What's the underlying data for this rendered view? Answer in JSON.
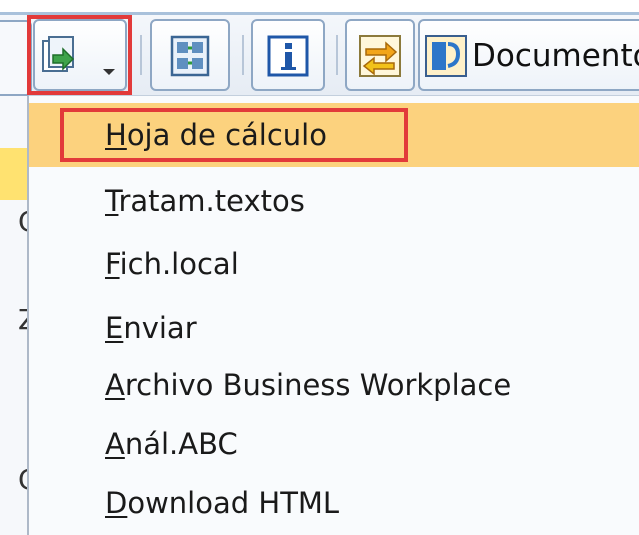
{
  "toolbar": {
    "buttons": [
      {
        "icon": "export-icon",
        "dropdown": true
      },
      {
        "icon": "layout-icon"
      },
      {
        "icon": "info-icon"
      },
      {
        "icon": "transfer-icon"
      },
      {
        "icon": "document-icon",
        "label": "Documento"
      }
    ]
  },
  "menu": {
    "items": [
      {
        "first": "H",
        "rest": "oja de cálculo",
        "selected": true
      },
      {
        "first": "T",
        "rest": "ratam.textos"
      },
      {
        "first": "F",
        "rest": "ich.local"
      },
      {
        "first": "E",
        "rest": "nviar"
      },
      {
        "first": "A",
        "rest": "rchivo Business Workplace"
      },
      {
        "first": "A",
        "rest": "nál.ABC"
      },
      {
        "first": "D",
        "rest": "ownload HTML"
      }
    ]
  },
  "left_partial": [
    "C",
    "Z",
    "C"
  ],
  "colors": {
    "selection": "#fcd27e",
    "highlight_border": "#e23a3a",
    "left_row_yellow": "#ffe270"
  }
}
